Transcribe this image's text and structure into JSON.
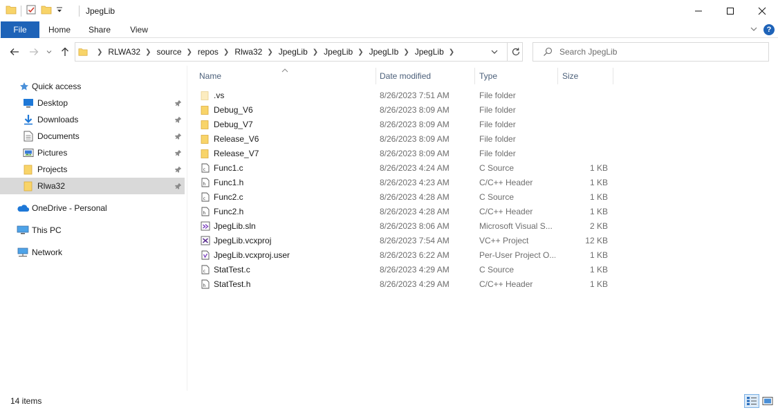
{
  "window": {
    "title": "JpegLib",
    "quick_access_toolbar": [
      "folder-icon",
      "properties-icon",
      "new-folder-icon",
      "customize-dropdown-icon"
    ]
  },
  "ribbon": {
    "tabs": [
      {
        "label": "File"
      },
      {
        "label": "Home"
      },
      {
        "label": "Share"
      },
      {
        "label": "View"
      }
    ]
  },
  "address_bar": {
    "breadcrumbs": [
      "RLWA32",
      "source",
      "repos",
      "Rlwa32",
      "JpegLib",
      "JpegLib",
      "JpegLIb",
      "JpegLib"
    ]
  },
  "search": {
    "placeholder": "Search JpegLib"
  },
  "nav_pane": {
    "quick_access": {
      "label": "Quick access"
    },
    "pinned": [
      {
        "label": "Desktop",
        "icon": "desktop-icon"
      },
      {
        "label": "Downloads",
        "icon": "downloads-icon"
      },
      {
        "label": "Documents",
        "icon": "documents-icon"
      },
      {
        "label": "Pictures",
        "icon": "pictures-icon"
      },
      {
        "label": "Projects",
        "icon": "folder-icon"
      },
      {
        "label": "Rlwa32",
        "icon": "folder-icon",
        "selected": true
      }
    ],
    "onedrive": {
      "label": "OneDrive - Personal"
    },
    "this_pc": {
      "label": "This PC"
    },
    "network": {
      "label": "Network"
    }
  },
  "file_list": {
    "columns": {
      "name": "Name",
      "date": "Date modified",
      "type": "Type",
      "size": "Size"
    },
    "rows": [
      {
        "name": ".vs",
        "date": "8/26/2023 7:51 AM",
        "type": "File folder",
        "size": "",
        "icon": "hidden-folder-icon"
      },
      {
        "name": "Debug_V6",
        "date": "8/26/2023 8:09 AM",
        "type": "File folder",
        "size": "",
        "icon": "folder-icon"
      },
      {
        "name": "Debug_V7",
        "date": "8/26/2023 8:09 AM",
        "type": "File folder",
        "size": "",
        "icon": "folder-icon"
      },
      {
        "name": "Release_V6",
        "date": "8/26/2023 8:09 AM",
        "type": "File folder",
        "size": "",
        "icon": "folder-icon"
      },
      {
        "name": "Release_V7",
        "date": "8/26/2023 8:09 AM",
        "type": "File folder",
        "size": "",
        "icon": "folder-icon"
      },
      {
        "name": "Func1.c",
        "date": "8/26/2023 4:24 AM",
        "type": "C Source",
        "size": "1 KB",
        "icon": "c-source-file-icon"
      },
      {
        "name": "Func1.h",
        "date": "8/26/2023 4:23 AM",
        "type": "C/C++ Header",
        "size": "1 KB",
        "icon": "header-file-icon"
      },
      {
        "name": "Func2.c",
        "date": "8/26/2023 4:28 AM",
        "type": "C Source",
        "size": "1 KB",
        "icon": "c-source-file-icon"
      },
      {
        "name": "Func2.h",
        "date": "8/26/2023 4:28 AM",
        "type": "C/C++ Header",
        "size": "1 KB",
        "icon": "header-file-icon"
      },
      {
        "name": "JpegLib.sln",
        "date": "8/26/2023 8:06 AM",
        "type": "Microsoft Visual S...",
        "size": "2 KB",
        "icon": "visual-studio-solution-icon"
      },
      {
        "name": "JpegLib.vcxproj",
        "date": "8/26/2023 7:54 AM",
        "type": "VC++ Project",
        "size": "12 KB",
        "icon": "vcxproj-file-icon"
      },
      {
        "name": "JpegLib.vcxproj.user",
        "date": "8/26/2023 6:22 AM",
        "type": "Per-User Project O...",
        "size": "1 KB",
        "icon": "user-project-file-icon"
      },
      {
        "name": "StatTest.c",
        "date": "8/26/2023 4:29 AM",
        "type": "C Source",
        "size": "1 KB",
        "icon": "c-source-file-icon"
      },
      {
        "name": "StatTest.h",
        "date": "8/26/2023 4:29 AM",
        "type": "C/C++ Header",
        "size": "1 KB",
        "icon": "header-file-icon"
      }
    ]
  },
  "status_bar": {
    "item_count": "14 items",
    "views": [
      "details-view-icon",
      "large-icons-view-icon"
    ]
  },
  "colors": {
    "accent": "#1e63b8",
    "folder": "#f8d469",
    "selected_nav": "#d9d9d9",
    "column_header_text": "#4c607a"
  }
}
